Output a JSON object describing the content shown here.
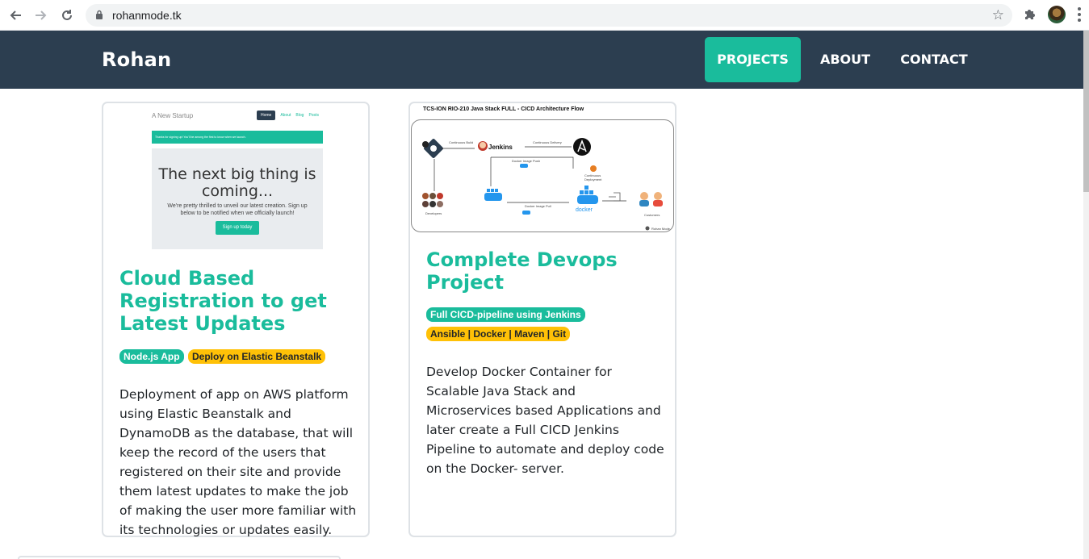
{
  "browser": {
    "url": "rohanmode.tk"
  },
  "navbar": {
    "brand": "Rohan",
    "items": [
      {
        "label": "PROJECTS",
        "active": true
      },
      {
        "label": "ABOUT",
        "active": false
      },
      {
        "label": "CONTACT",
        "active": false
      }
    ]
  },
  "colors": {
    "navbar_bg": "#2c3e50",
    "accent": "#1abc9c",
    "badge_yellow": "#ffc107"
  },
  "projects": [
    {
      "image": {
        "brand": "A New Startup",
        "nav": [
          "Home",
          "About",
          "Blog",
          "Posts"
        ],
        "alert": "Thanks for signing up! You'll be among the first to know when we launch.",
        "heading": "The next big thing is coming...",
        "text": "We're pretty thrilled to unveil our latest creation. Sign up below to be notified when we officially launch!",
        "button": "Sign up today"
      },
      "title": "Cloud Based Registration to get Latest Updates",
      "badges": [
        "Node.js App",
        "Deploy on Elastic Beanstalk"
      ],
      "description": "Deployment of app on AWS platform using Elastic Beanstalk and DynamoDB as the database, that will keep the record of the users that registered on their site and provide them latest updates to make the job of making the user more familiar with its technologies or updates easily."
    },
    {
      "image": {
        "title": "TCS-ION RIO-210 Java Stack FULL - CICD Architecture Flow",
        "labels": [
          "Jenkins",
          "docker",
          "Developers",
          "Continuous Build",
          "Continuous Delivery",
          "Docker Image Push",
          "Docker Image Pull",
          "Continuous Deployment",
          "Customers",
          "Rohan Mode"
        ]
      },
      "title": "Complete Devops Project",
      "badges": [
        "Full CICD-pipeline using Jenkins",
        "Ansible | Docker | Maven | Git"
      ],
      "description": "Develop Docker Container for Scalable Java Stack and Microservices based Applications and later create a Full CICD Jenkins Pipeline to automate and deploy code on the Docker- server."
    }
  ]
}
